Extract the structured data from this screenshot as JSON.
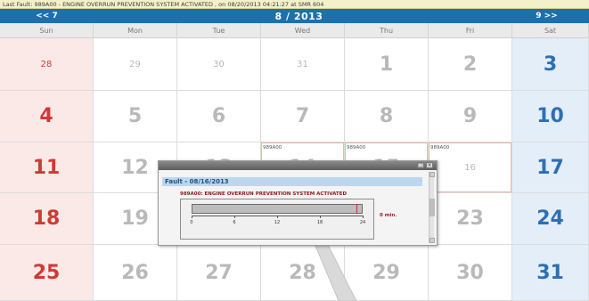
{
  "fault_bar": {
    "text": "Last Fault:  989A00  -  ENGINE OVERRUN PREVENTION SYSTEM ACTIVATED , on 08/20/2013 04:21:27 at SMR   604"
  },
  "nav": {
    "prev_label": "<< 7",
    "month_label": "8 / 2013",
    "next_label": "9 >>"
  },
  "weekdays": [
    "Sun",
    "Mon",
    "Tue",
    "Wed",
    "Thu",
    "Fri",
    "Sat"
  ],
  "weeks": [
    [
      "28",
      "29",
      "30",
      "31",
      "1",
      "2",
      "3"
    ],
    [
      "4",
      "5",
      "6",
      "7",
      "8",
      "9",
      "10"
    ],
    [
      "11",
      "12",
      "13",
      "14",
      "15",
      "16",
      "17"
    ],
    [
      "18",
      "19",
      "20",
      "21",
      "22",
      "23",
      "24"
    ],
    [
      "25",
      "26",
      "27",
      "28",
      "29",
      "30",
      "31"
    ]
  ],
  "fault_tags": {
    "wed_row3": "989A00",
    "thu_row3": "989A00",
    "fri_row3": "989A00"
  },
  "popup": {
    "header": "Fault - 08/16/2013",
    "fault_title": "989A00: ENGINE OVERRUN PREVENTION SYSTEM ACTIVATED",
    "ticks": [
      "0",
      "6",
      "12",
      "18",
      "24"
    ],
    "duration": "0 min.",
    "event_hour_fraction": 0.96
  },
  "colors": {
    "nav_blue": "#1d6fb0",
    "sunday_red": "#cf3a35",
    "saturday_blue": "#2d6fb5"
  }
}
